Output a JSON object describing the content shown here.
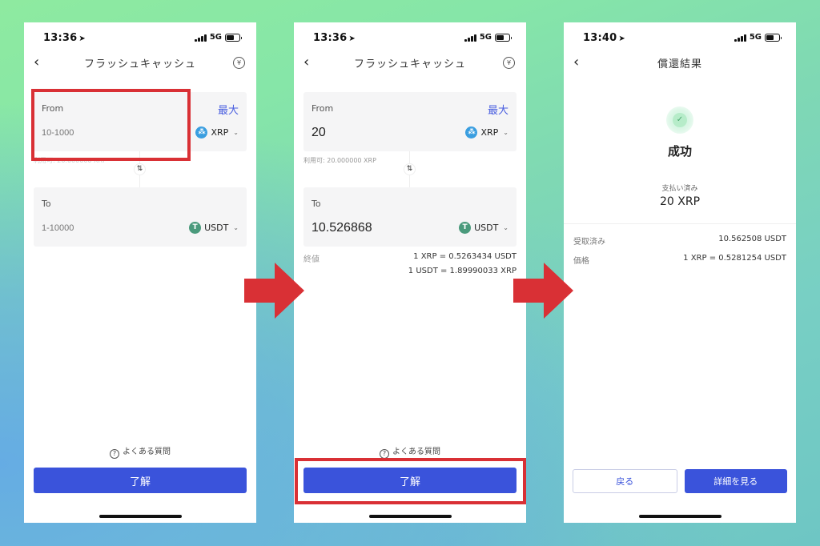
{
  "colors": {
    "accent": "#3a53db",
    "highlight": "#d93035",
    "xrp_icon": "#3a9ee0",
    "usdt_icon": "#4a9a7c",
    "success": "#4aa870"
  },
  "screens": [
    {
      "status": {
        "time": "13:36",
        "network": "5G"
      },
      "nav": {
        "title": "フラッシュキャッシュ",
        "back_icon": "chevron-left-icon",
        "history_icon": "currency-history-icon"
      },
      "from": {
        "label": "From",
        "max_label": "最大",
        "value": "",
        "placeholder": "10-1000",
        "coin": "XRP"
      },
      "available": "利用可: 20.000000 XRP",
      "to": {
        "label": "To",
        "value": "",
        "placeholder": "1-10000",
        "coin": "USDT"
      },
      "faq": "よくある質問",
      "confirm_label": "了解"
    },
    {
      "status": {
        "time": "13:36",
        "network": "5G"
      },
      "nav": {
        "title": "フラッシュキャッシュ",
        "back_icon": "chevron-left-icon",
        "history_icon": "currency-history-icon"
      },
      "from": {
        "label": "From",
        "max_label": "最大",
        "value": "20",
        "placeholder": "10-1000",
        "coin": "XRP"
      },
      "available": "利用可: 20.000000 XRP",
      "to": {
        "label": "To",
        "value": "10.526868",
        "placeholder": "1-10000",
        "coin": "USDT"
      },
      "rate": {
        "label": "終値",
        "line1": "1 XRP = 0.5263434 USDT",
        "line2": "1 USDT = 1.89990033 XRP"
      },
      "faq": "よくある質問",
      "confirm_label": "了解"
    },
    {
      "status": {
        "time": "13:40",
        "network": "5G"
      },
      "nav": {
        "title": "償還結果",
        "back_icon": "chevron-left-icon"
      },
      "result": {
        "title": "成功",
        "paid_label": "支払い済み",
        "paid_value": "20 XRP",
        "received_label": "受取済み",
        "received_value": "10.562508 USDT",
        "price_label": "価格",
        "price_value": "1 XRP = 0.5281254 USDT"
      },
      "back_label": "戻る",
      "details_label": "詳細を見る"
    }
  ],
  "glyphs": {
    "back": "‹",
    "location": "➤",
    "swap": "⇅",
    "chevron": "⌄",
    "check": "✓",
    "question": "?",
    "xrp": "⁂",
    "usdt": "T",
    "history": "¥"
  }
}
